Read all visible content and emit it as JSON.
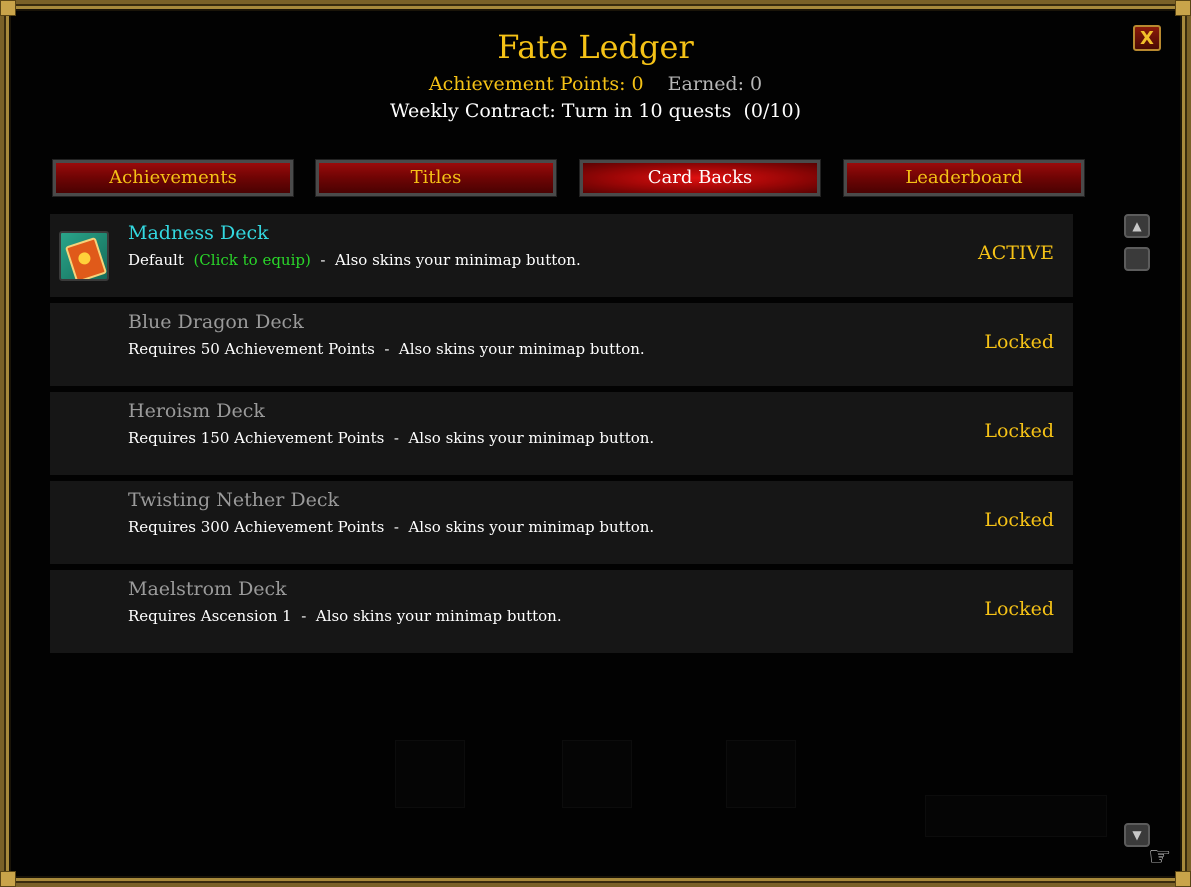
{
  "window": {
    "title": "Fate Ledger",
    "close_label": "X",
    "achievement_points": "Achievement Points: 0",
    "earned": "Earned: 0",
    "weekly_contract": "Weekly Contract: Turn in 10 quests  (0/10)"
  },
  "tabs": [
    {
      "label": "Achievements",
      "active": false
    },
    {
      "label": "Titles",
      "active": false
    },
    {
      "label": "Card Backs",
      "active": true
    },
    {
      "label": "Leaderboard",
      "active": false
    }
  ],
  "card_backs": [
    {
      "name": "Madness Deck",
      "req": "Default",
      "hint": "(Click to equip)",
      "suffix": "  -  Also skins your minimap button.",
      "status": "ACTIVE",
      "unlocked": true,
      "icon": "madness-deck-icon"
    },
    {
      "name": "Blue Dragon Deck",
      "req": "Requires 50 Achievement Points",
      "hint": "",
      "suffix": "  -  Also skins your minimap button.",
      "status": "Locked",
      "unlocked": false
    },
    {
      "name": "Heroism Deck",
      "req": "Requires 150 Achievement Points",
      "hint": "",
      "suffix": "  -  Also skins your minimap button.",
      "status": "Locked",
      "unlocked": false
    },
    {
      "name": "Twisting Nether Deck",
      "req": "Requires 300 Achievement Points",
      "hint": "",
      "suffix": "  -  Also skins your minimap button.",
      "status": "Locked",
      "unlocked": false
    },
    {
      "name": "Maelstrom Deck",
      "req": "Requires Ascension 1",
      "hint": "",
      "suffix": "  -  Also skins your minimap button.",
      "status": "Locked",
      "unlocked": false
    }
  ],
  "colors": {
    "gold": "#f5c216",
    "cyan_name": "#33d8e0",
    "green_hint": "#2ad62a",
    "tab_red": "#9a0b0b"
  }
}
